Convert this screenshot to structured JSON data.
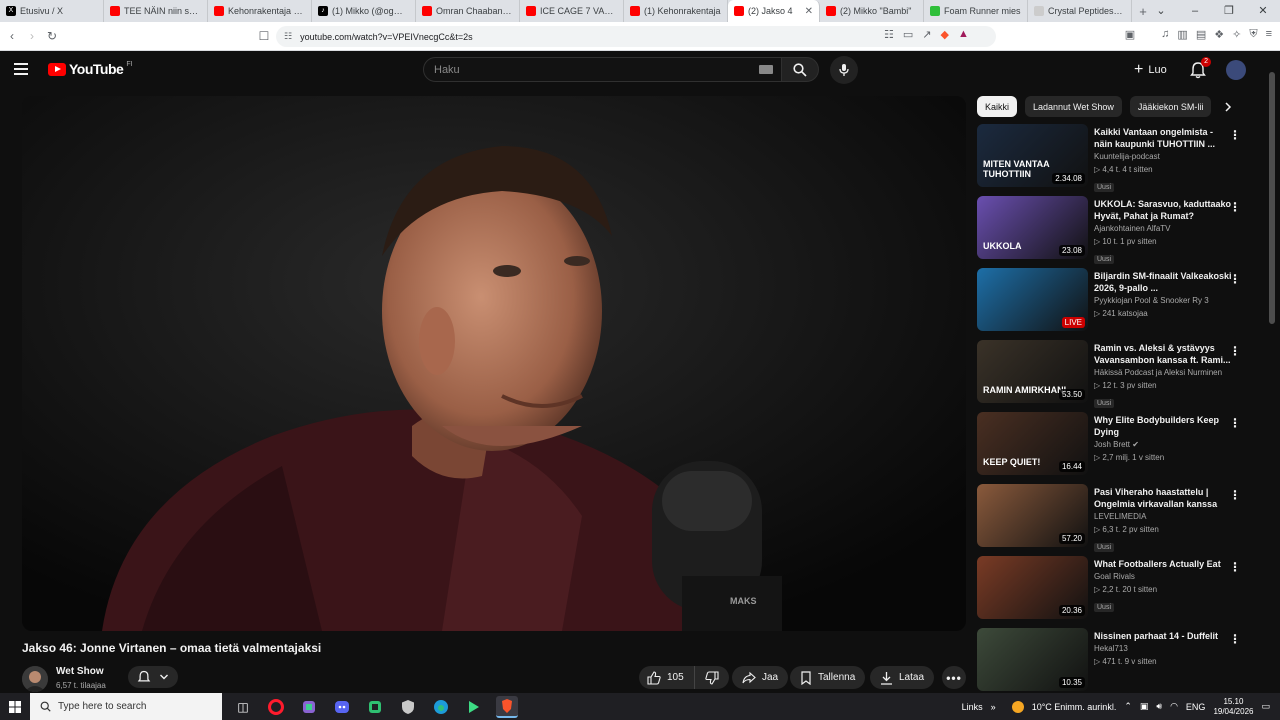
{
  "browser": {
    "tabs": [
      {
        "title": "Etusivu / X",
        "fav_color": "#000000",
        "fav_text": "X"
      },
      {
        "title": "TEE NÄIN niin saat",
        "fav_color": "#ff0000",
        "fav_text": ""
      },
      {
        "title": "Kehonrakentaja kilp",
        "fav_color": "#ff0000",
        "fav_text": ""
      },
      {
        "title": "(1) Mikko (@ogmikk",
        "fav_color": "#000000",
        "fav_text": "♪"
      },
      {
        "title": "Omran Chaaban - V",
        "fav_color": "#ff0000",
        "fav_text": ""
      },
      {
        "title": "ICE CAGE 7 VASTU",
        "fav_color": "#ff0000",
        "fav_text": ""
      },
      {
        "title": "(1) Kehonrakentaja",
        "fav_color": "#ff0000",
        "fav_text": ""
      },
      {
        "title": "(2) Jakso 4",
        "fav_color": "#ff0000",
        "fav_text": "",
        "active": true
      },
      {
        "title": "(2) Mikko \"Bambi\"",
        "fav_color": "#ff0000",
        "fav_text": ""
      },
      {
        "title": "Foam Runner mies",
        "fav_color": "#2fbf3a",
        "fav_text": ""
      },
      {
        "title": "Crystal Peptides – P",
        "fav_color": "#cccccc",
        "fav_text": ""
      }
    ],
    "new_tab": "+",
    "window_controls": [
      "⌄",
      "–",
      "❐",
      "✕"
    ],
    "url": "youtube.com/watch?v=VPEIVnecgCc&t=2s"
  },
  "youtube": {
    "logo_text": "YouTube",
    "region": "FI",
    "search_placeholder": "Haku",
    "create_label": "Luo",
    "notification_count": "2"
  },
  "video": {
    "title": "Jakso 46: Jonne Virtanen – omaa tietä valmentajaksi",
    "channel": "Wet Show",
    "subscribers": "6,57 t. tilaajaa",
    "likes": "105",
    "share_label": "Jaa",
    "save_label": "Tallenna",
    "download_label": "Lataa"
  },
  "chips": [
    "Kaikki",
    "Ladannut Wet Show",
    "Jääkiekon SM-lii"
  ],
  "recommendations": [
    {
      "title": "Kaikki Vantaan ongelmista - näin kaupunki TUHOTTIIN ...",
      "channel": "Kuuntelija-podcast",
      "stats": "▷ 4,4 t.   4 t sitten",
      "badge": "Uusi",
      "duration": "2.34.08",
      "thumb_bg": "#1b2a3f",
      "caption": "MITEN VANTAA TUHOTTIIN",
      "live": false,
      "verified": false
    },
    {
      "title": "UKKOLA: Sarasvuo, kaduttaako Hyvät, Pahat ja Rumat?",
      "channel": "Ajankohtainen AlfaTV",
      "stats": "▷ 10 t.   1 pv sitten",
      "badge": "Uusi",
      "duration": "23.08",
      "thumb_bg": "#6a4fb0",
      "caption": "UKKOLA",
      "live": false,
      "verified": false
    },
    {
      "title": "Biljardin SM-finaalit Valkeakoski 2026, 9-pallo ...",
      "channel": "Pyykkiojan Pool & Snooker Ry 3",
      "stats": "▷ 241 katsojaa",
      "badge": "",
      "duration": "LIVE",
      "thumb_bg": "#1d6fa8",
      "caption": "",
      "live": true,
      "verified": false
    },
    {
      "title": "Ramin vs. Aleksi & ystävyys Vavansambon kanssa ft. Rami...",
      "channel": "Häkissä Podcast ja Aleksi Nurminen",
      "stats": "▷ 12 t.   3 pv sitten",
      "badge": "Uusi",
      "duration": "53.50",
      "thumb_bg": "#3a3228",
      "caption": "RAMIN AMIRKHANI",
      "live": false,
      "verified": false
    },
    {
      "title": "Why Elite Bodybuilders Keep Dying",
      "channel": "Josh Brett",
      "stats": "▷ 2,7 milj.   1 v sitten",
      "badge": "",
      "duration": "16.44",
      "thumb_bg": "#4a2f22",
      "caption": "KEEP QUIET!",
      "live": false,
      "verified": true
    },
    {
      "title": "Pasi Viheraho haastattelu | Ongelmia virkavallan kanssa",
      "channel": "LEVELIMEDIA",
      "stats": "▷ 6,3 t.   2 pv sitten",
      "badge": "Uusi",
      "duration": "57.20",
      "thumb_bg": "#8a5a3c",
      "caption": "",
      "live": false,
      "verified": false
    },
    {
      "title": "What Footballers Actually Eat",
      "channel": "Goal Rivals",
      "stats": "▷ 2,2 t.   20 t sitten",
      "badge": "Uusi",
      "duration": "20.36",
      "thumb_bg": "#7a3b25",
      "caption": "",
      "live": false,
      "verified": false
    },
    {
      "title": "Nissinen parhaat 14 - Duffelit",
      "channel": "Hekal713",
      "stats": "▷ 471 t.   9 v sitten",
      "badge": "",
      "duration": "10.35",
      "thumb_bg": "#3d4a3a",
      "caption": "",
      "live": false,
      "verified": false
    }
  ],
  "taskbar": {
    "search_placeholder": "Type here to search",
    "links_label": "Links",
    "weather": "10°C  Enimm. aurinkl.",
    "language": "ENG",
    "time": "15.10",
    "date": "19/04/2026"
  }
}
